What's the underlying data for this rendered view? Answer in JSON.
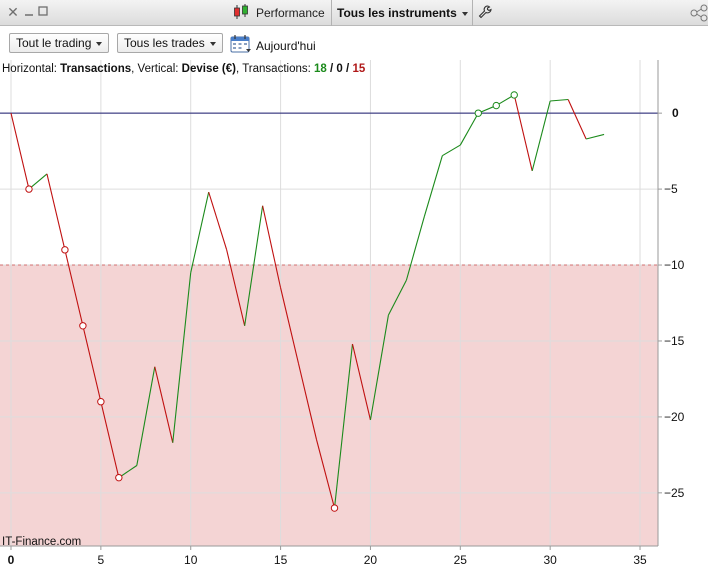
{
  "titlebar": {
    "performance_label": "Performance",
    "instruments_label": "Tous les instruments",
    "icons": [
      "close-icon",
      "minimize-icon",
      "maximize-icon",
      "candlestick-icon",
      "wrench-icon",
      "share-icon"
    ]
  },
  "toolbar": {
    "trading_filter": "Tout le trading",
    "trades_filter": "Tous les trades",
    "date_label": "Aujourd'hui"
  },
  "info": {
    "horizontal_key": "Horizontal:",
    "horizontal_val": "Transactions",
    "vertical_key": "Vertical:",
    "vertical_val": "Devise (€)",
    "transactions_key": "Transactions:",
    "wins": "18",
    "neutral": "0",
    "losses": "15",
    "sep1": ",",
    "sep2": ",",
    "slash": "/"
  },
  "watermark": "IT-Finance.com",
  "colors": {
    "gain": "#1b8a1b",
    "loss": "#c01010",
    "zero_line": "#1a1a6e",
    "drawdown_fill": "#f4d4d4",
    "drawdown_line": "#d07070"
  },
  "chart_data": {
    "type": "line",
    "xlabel": "",
    "ylabel": "",
    "xlim": [
      0,
      36
    ],
    "ylim": [
      -28.5,
      3.5
    ],
    "x_ticks": [
      0,
      5,
      10,
      15,
      20,
      25,
      30,
      35
    ],
    "y_ticks": [
      0,
      -5,
      -10,
      -15,
      -20,
      -25
    ],
    "drawdown_threshold": -10,
    "grid": true,
    "x": [
      0,
      1,
      2,
      3,
      4,
      5,
      6,
      7,
      8,
      9,
      10,
      11,
      12,
      13,
      14,
      15,
      16,
      17,
      18,
      19,
      20,
      21,
      22,
      23,
      24,
      25,
      26,
      27,
      28,
      29,
      30,
      31,
      32,
      33
    ],
    "values": [
      0,
      -5,
      -4,
      -9,
      -14,
      -19,
      -24,
      -23.2,
      -16.7,
      -21.7,
      -10.5,
      -5.2,
      -9,
      -14,
      -6.1,
      -11.5,
      -16.5,
      -21.5,
      -26,
      -15.2,
      -20.2,
      -13.3,
      -11,
      -6.8,
      -2.8,
      -2.1,
      0,
      0.5,
      1.2,
      -3.8,
      0.8,
      0.9,
      -1.7,
      -1.4
    ],
    "markers": [
      1,
      3,
      4,
      5,
      6,
      18,
      26,
      27,
      28
    ]
  }
}
